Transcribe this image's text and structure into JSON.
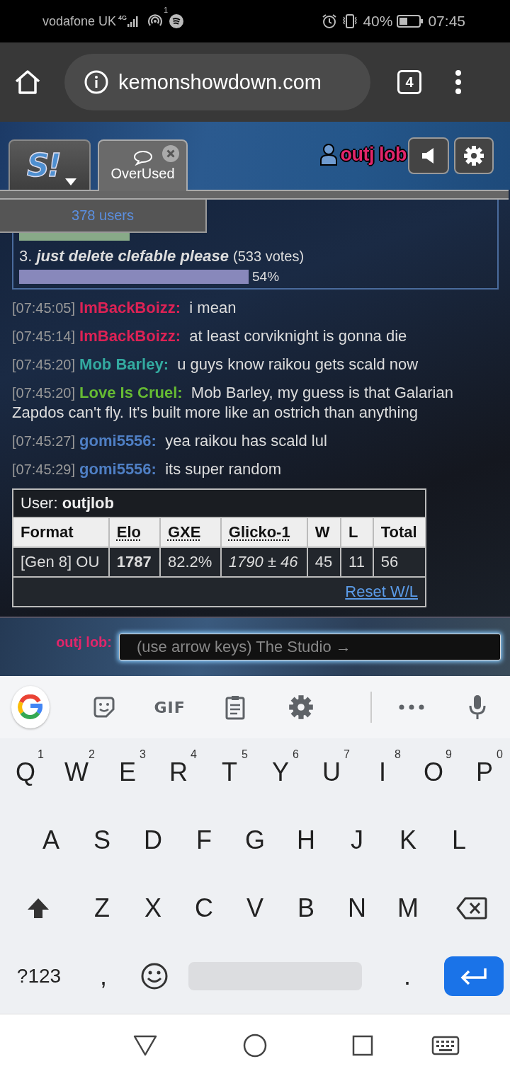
{
  "status_bar": {
    "carrier": "vodafone UK",
    "network": "4G",
    "notification_count": "1",
    "battery": "40%",
    "time": "07:45"
  },
  "browser": {
    "url": "kemonshowdown.com",
    "tab_count": "4"
  },
  "header": {
    "tabs": [
      {
        "kind": "home",
        "logo": "S!",
        "selected": false
      },
      {
        "kind": "room",
        "label": "OverUsed",
        "selected": true
      }
    ],
    "username": "outj lob"
  },
  "user_count": "378 users",
  "poll": {
    "options": [
      {
        "color": "#88aa88"
      },
      {
        "number": "3.",
        "label": "just delete clefable please",
        "votes": "(533 votes)",
        "percent": "54%",
        "color": "#8888bb"
      }
    ]
  },
  "messages": [
    {
      "time": "[07:45:05]",
      "user": "ImBackBoizz:",
      "color": "#dd2255",
      "text": "i mean"
    },
    {
      "time": "[07:45:14]",
      "user": "ImBackBoizz:",
      "color": "#dd2255",
      "text": "at least corviknight is gonna die"
    },
    {
      "time": "[07:45:20]",
      "user": "Mob Barley:",
      "color": "#33aaa0",
      "text": "u guys know raikou gets scald now"
    },
    {
      "time": "[07:45:20]",
      "user": "Love Is Cruel:",
      "color": "#66bb33",
      "text": "Mob Barley, my guess is that Galarian Zapdos can't fly. It's built more like an ostrich than anything"
    },
    {
      "time": "[07:45:27]",
      "user": "gomi5556:",
      "color": "#4f7fc4",
      "text": "yea raikou has scald lul"
    },
    {
      "time": "[07:45:29]",
      "user": "gomi5556:",
      "color": "#4f7fc4",
      "text": "its super random"
    }
  ],
  "rank_table": {
    "caption": "User: **outjlob**",
    "columns": [
      {
        "label": "Format",
        "abbr": false
      },
      {
        "label": "Elo",
        "abbr": true
      },
      {
        "label": "GXE",
        "abbr": true
      },
      {
        "label": "Glicko-1",
        "abbr": true
      },
      {
        "label": "W",
        "abbr": false
      },
      {
        "label": "L",
        "abbr": false
      },
      {
        "label": "Total",
        "abbr": false
      }
    ],
    "row": [
      "[Gen 8] OU",
      "1787",
      "82.2%",
      "1790 ± 46",
      "45",
      "11",
      "56"
    ],
    "link": "Reset W/L"
  },
  "chat_input": {
    "label": "outj lob:",
    "placeholder": "(use arrow keys) The Studio →"
  },
  "keyboard": {
    "gif_label": "GIF",
    "rows": [
      [
        {
          "key": "Q",
          "hint": "1"
        },
        {
          "key": "W",
          "hint": "2"
        },
        {
          "key": "E",
          "hint": "3"
        },
        {
          "key": "R",
          "hint": "4"
        },
        {
          "key": "T",
          "hint": "5"
        },
        {
          "key": "Y",
          "hint": "6"
        },
        {
          "key": "U",
          "hint": "7"
        },
        {
          "key": "I",
          "hint": "8"
        },
        {
          "key": "O",
          "hint": "9"
        },
        {
          "key": "P",
          "hint": "0"
        }
      ],
      [
        {
          "key": "A"
        },
        {
          "key": "S"
        },
        {
          "key": "D"
        },
        {
          "key": "F"
        },
        {
          "key": "G"
        },
        {
          "key": "H"
        },
        {
          "key": "J"
        },
        {
          "key": "K"
        },
        {
          "key": "L"
        }
      ],
      [
        {
          "key": "Z"
        },
        {
          "key": "X"
        },
        {
          "key": "C"
        },
        {
          "key": "V"
        },
        {
          "key": "B"
        },
        {
          "key": "N"
        },
        {
          "key": "M"
        }
      ]
    ],
    "symbols_key": "?123",
    "comma": ",",
    "period": "."
  }
}
